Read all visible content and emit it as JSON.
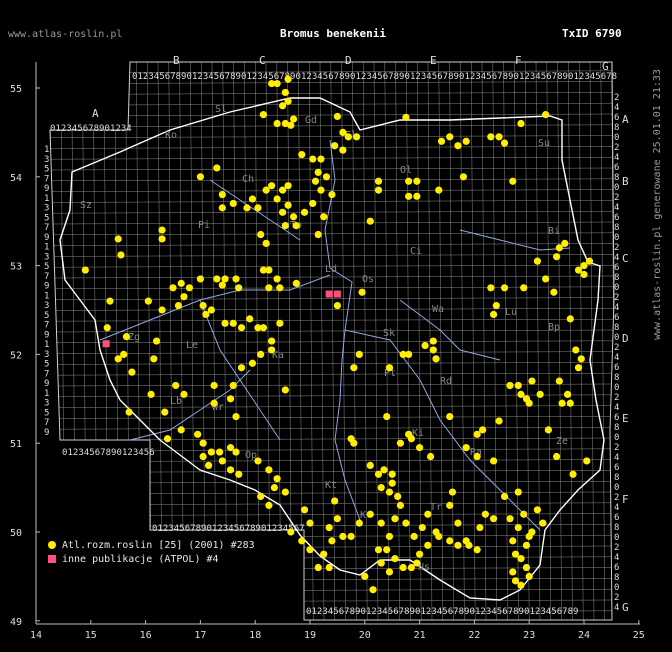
{
  "site": "www.atlas-roslin.pl",
  "title": "Bromus benekenii",
  "txid": "TxID 6790",
  "side_text": "www.atlas-roslin.pl generowane 25.01.01 21:33",
  "colors": {
    "background": "#000000",
    "grid": "#8a8a8a",
    "border": "#ffffff",
    "rivers": "#8fa8e0",
    "dot": "#ffee00",
    "square": "#ff4f7a"
  },
  "axis_x": [
    "14",
    "15",
    "16",
    "17",
    "18",
    "19",
    "20",
    "21",
    "22",
    "23",
    "24",
    "25"
  ],
  "axis_y": [
    "55",
    "54",
    "53",
    "52",
    "51",
    "50",
    "49"
  ],
  "col_letters": [
    "A",
    "B",
    "C",
    "D",
    "E",
    "F",
    "G"
  ],
  "row_letters": [
    "A",
    "B",
    "C",
    "D",
    "E",
    "F",
    "G"
  ],
  "grid_digits": "0123456789",
  "region_labels": [
    "Sz",
    "Ko",
    "Sl",
    "Gd",
    "El",
    "Ol",
    "Su",
    "Pi",
    "Ch",
    "To",
    "Bi",
    "Ci",
    "Os",
    "Ld",
    "Wa",
    "Sk",
    "Bp",
    "Le",
    "Ka",
    "Pt",
    "Rd",
    "Lu",
    "Zg",
    "Lb",
    "Wr",
    "Op",
    "Kt",
    "Ki",
    "Tr",
    "Kr",
    "Ns",
    "Ra",
    "Ze"
  ],
  "legend": [
    {
      "label": "Atl.rozm.roslin [25] (2001) #283",
      "symbol": "dot"
    },
    {
      "label": "inne publikacje (ATPOL) #4",
      "symbol": "square"
    }
  ],
  "records_dots": [
    [
      18.3,
      55.05
    ],
    [
      18.4,
      55.05
    ],
    [
      18.6,
      55.1
    ],
    [
      18.55,
      54.95
    ],
    [
      18.6,
      54.85
    ],
    [
      18.5,
      54.8
    ],
    [
      18.15,
      54.7
    ],
    [
      18.4,
      54.6
    ],
    [
      18.7,
      54.65
    ],
    [
      18.55,
      54.6
    ],
    [
      18.65,
      54.58
    ],
    [
      19.5,
      54.68
    ],
    [
      19.6,
      54.5
    ],
    [
      19.7,
      54.45
    ],
    [
      19.45,
      54.35
    ],
    [
      19.6,
      54.3
    ],
    [
      19.85,
      54.45
    ],
    [
      20.75,
      54.67
    ],
    [
      21.4,
      54.4
    ],
    [
      21.55,
      54.45
    ],
    [
      21.7,
      54.35
    ],
    [
      21.85,
      54.4
    ],
    [
      22.3,
      54.45
    ],
    [
      22.45,
      54.45
    ],
    [
      22.55,
      54.38
    ],
    [
      22.85,
      54.6
    ],
    [
      23.3,
      54.7
    ],
    [
      18.85,
      54.25
    ],
    [
      19.05,
      54.2
    ],
    [
      19.2,
      54.2
    ],
    [
      19.15,
      54.05
    ],
    [
      19.1,
      53.95
    ],
    [
      19.3,
      54.0
    ],
    [
      19.2,
      53.85
    ],
    [
      19.4,
      53.8
    ],
    [
      20.25,
      53.95
    ],
    [
      20.25,
      53.85
    ],
    [
      20.8,
      53.95
    ],
    [
      20.95,
      53.95
    ],
    [
      20.8,
      53.78
    ],
    [
      20.95,
      53.78
    ],
    [
      21.35,
      53.85
    ],
    [
      21.8,
      54.0
    ],
    [
      22.7,
      53.95
    ],
    [
      17.0,
      54.0
    ],
    [
      17.3,
      54.1
    ],
    [
      17.4,
      53.8
    ],
    [
      17.6,
      53.7
    ],
    [
      17.4,
      53.65
    ],
    [
      17.95,
      53.75
    ],
    [
      17.85,
      53.65
    ],
    [
      18.05,
      53.65
    ],
    [
      18.2,
      53.85
    ],
    [
      18.3,
      53.9
    ],
    [
      18.5,
      53.85
    ],
    [
      18.6,
      53.9
    ],
    [
      18.4,
      53.75
    ],
    [
      18.6,
      53.68
    ],
    [
      18.5,
      53.6
    ],
    [
      18.7,
      53.55
    ],
    [
      18.55,
      53.45
    ],
    [
      18.75,
      53.45
    ],
    [
      18.9,
      53.6
    ],
    [
      19.05,
      53.7
    ],
    [
      19.25,
      53.55
    ],
    [
      19.15,
      53.35
    ],
    [
      20.1,
      53.5
    ],
    [
      18.1,
      53.35
    ],
    [
      18.2,
      53.25
    ],
    [
      15.5,
      53.3
    ],
    [
      15.55,
      53.12
    ],
    [
      16.3,
      53.4
    ],
    [
      16.3,
      53.3
    ],
    [
      14.9,
      52.95
    ],
    [
      16.65,
      52.8
    ],
    [
      16.8,
      52.75
    ],
    [
      16.7,
      52.65
    ],
    [
      16.5,
      52.75
    ],
    [
      16.6,
      52.55
    ],
    [
      17.0,
      52.85
    ],
    [
      17.3,
      52.85
    ],
    [
      17.45,
      52.85
    ],
    [
      17.4,
      52.78
    ],
    [
      17.65,
      52.85
    ],
    [
      17.7,
      52.75
    ],
    [
      18.15,
      52.95
    ],
    [
      18.25,
      52.95
    ],
    [
      18.4,
      52.85
    ],
    [
      18.25,
      52.75
    ],
    [
      18.45,
      52.75
    ],
    [
      18.75,
      52.8
    ],
    [
      16.05,
      52.6
    ],
    [
      17.05,
      52.55
    ],
    [
      17.2,
      52.5
    ],
    [
      17.1,
      52.45
    ],
    [
      17.45,
      52.35
    ],
    [
      17.6,
      52.35
    ],
    [
      17.9,
      52.4
    ],
    [
      17.75,
      52.3
    ],
    [
      18.05,
      52.3
    ],
    [
      18.15,
      52.3
    ],
    [
      18.45,
      52.35
    ],
    [
      18.3,
      52.15
    ],
    [
      18.3,
      52.05
    ],
    [
      18.1,
      52.0
    ],
    [
      17.95,
      51.9
    ],
    [
      17.75,
      51.85
    ],
    [
      18.55,
      51.6
    ],
    [
      15.35,
      52.6
    ],
    [
      15.3,
      52.3
    ],
    [
      15.65,
      52.2
    ],
    [
      15.6,
      52.0
    ],
    [
      16.3,
      52.5
    ],
    [
      16.2,
      52.15
    ],
    [
      15.5,
      51.95
    ],
    [
      15.75,
      51.8
    ],
    [
      16.15,
      51.95
    ],
    [
      16.55,
      51.65
    ],
    [
      16.7,
      51.55
    ],
    [
      17.25,
      51.65
    ],
    [
      17.6,
      51.65
    ],
    [
      17.25,
      51.45
    ],
    [
      17.55,
      51.5
    ],
    [
      17.65,
      51.3
    ],
    [
      16.1,
      51.55
    ],
    [
      16.35,
      51.35
    ],
    [
      15.7,
      51.35
    ],
    [
      16.65,
      51.15
    ],
    [
      16.4,
      51.05
    ],
    [
      16.95,
      51.1
    ],
    [
      17.05,
      51.0
    ],
    [
      17.2,
      50.9
    ],
    [
      17.35,
      50.9
    ],
    [
      17.55,
      50.95
    ],
    [
      17.65,
      50.9
    ],
    [
      17.4,
      50.8
    ],
    [
      17.55,
      50.7
    ],
    [
      17.7,
      50.65
    ],
    [
      17.05,
      50.85
    ],
    [
      17.15,
      50.75
    ],
    [
      18.05,
      50.8
    ],
    [
      18.25,
      50.7
    ],
    [
      18.4,
      50.6
    ],
    [
      18.55,
      50.45
    ],
    [
      18.35,
      50.5
    ],
    [
      18.1,
      50.4
    ],
    [
      18.25,
      50.3
    ],
    [
      19.95,
      52.7
    ],
    [
      19.5,
      52.55
    ],
    [
      19.9,
      52.0
    ],
    [
      19.8,
      51.85
    ],
    [
      20.7,
      52.0
    ],
    [
      20.8,
      52.0
    ],
    [
      21.1,
      52.1
    ],
    [
      21.25,
      52.15
    ],
    [
      21.25,
      52.05
    ],
    [
      21.3,
      51.95
    ],
    [
      20.45,
      51.85
    ],
    [
      19.8,
      51.0
    ],
    [
      19.75,
      51.05
    ],
    [
      20.1,
      50.75
    ],
    [
      20.25,
      50.65
    ],
    [
      20.35,
      50.7
    ],
    [
      20.5,
      50.65
    ],
    [
      20.5,
      50.55
    ],
    [
      20.65,
      51.0
    ],
    [
      20.85,
      51.05
    ],
    [
      21.0,
      50.95
    ],
    [
      21.2,
      50.85
    ],
    [
      20.4,
      51.3
    ],
    [
      20.8,
      51.1
    ],
    [
      21.85,
      50.95
    ],
    [
      22.05,
      51.1
    ],
    [
      22.15,
      51.15
    ],
    [
      22.45,
      51.25
    ],
    [
      22.05,
      50.85
    ],
    [
      22.35,
      50.8
    ],
    [
      21.55,
      51.3
    ],
    [
      22.3,
      52.75
    ],
    [
      22.55,
      52.75
    ],
    [
      22.35,
      52.45
    ],
    [
      22.4,
      52.55
    ],
    [
      22.9,
      52.75
    ],
    [
      23.45,
      52.7
    ],
    [
      23.15,
      53.05
    ],
    [
      23.3,
      52.85
    ],
    [
      23.5,
      53.1
    ],
    [
      23.55,
      53.2
    ],
    [
      23.65,
      53.25
    ],
    [
      24.0,
      53.0
    ],
    [
      23.9,
      52.95
    ],
    [
      24.1,
      53.05
    ],
    [
      24.0,
      52.9
    ],
    [
      23.75,
      52.4
    ],
    [
      23.85,
      52.05
    ],
    [
      23.95,
      51.95
    ],
    [
      23.9,
      51.85
    ],
    [
      23.55,
      51.7
    ],
    [
      23.7,
      51.55
    ],
    [
      23.75,
      51.45
    ],
    [
      23.6,
      51.45
    ],
    [
      22.85,
      51.55
    ],
    [
      22.95,
      51.5
    ],
    [
      23.0,
      51.45
    ],
    [
      22.65,
      51.65
    ],
    [
      22.8,
      51.65
    ],
    [
      23.05,
      51.7
    ],
    [
      23.2,
      51.55
    ],
    [
      23.35,
      51.15
    ],
    [
      23.5,
      50.85
    ],
    [
      23.8,
      50.65
    ],
    [
      24.05,
      50.8
    ],
    [
      23.15,
      50.25
    ],
    [
      23.25,
      50.1
    ],
    [
      23.05,
      50.0
    ],
    [
      23.0,
      49.95
    ],
    [
      22.95,
      49.85
    ],
    [
      22.85,
      49.7
    ],
    [
      22.95,
      49.6
    ],
    [
      23.0,
      49.5
    ],
    [
      22.75,
      49.45
    ],
    [
      22.85,
      49.4
    ],
    [
      22.7,
      49.55
    ],
    [
      22.75,
      49.75
    ],
    [
      22.7,
      49.9
    ],
    [
      22.8,
      50.05
    ],
    [
      22.9,
      50.2
    ],
    [
      22.65,
      50.15
    ],
    [
      22.55,
      50.4
    ],
    [
      22.8,
      50.45
    ],
    [
      22.35,
      50.15
    ],
    [
      22.2,
      50.2
    ],
    [
      22.1,
      50.05
    ],
    [
      21.9,
      49.85
    ],
    [
      22.05,
      49.8
    ],
    [
      21.85,
      49.9
    ],
    [
      21.7,
      49.85
    ],
    [
      21.55,
      49.9
    ],
    [
      21.35,
      49.95
    ],
    [
      21.15,
      49.85
    ],
    [
      21.0,
      49.75
    ],
    [
      20.95,
      49.65
    ],
    [
      20.85,
      49.6
    ],
    [
      20.7,
      49.6
    ],
    [
      20.55,
      49.7
    ],
    [
      20.4,
      49.8
    ],
    [
      20.25,
      49.8
    ],
    [
      20.3,
      49.65
    ],
    [
      20.45,
      49.55
    ],
    [
      20.15,
      49.35
    ],
    [
      20.0,
      49.5
    ],
    [
      19.75,
      49.95
    ],
    [
      19.9,
      50.1
    ],
    [
      20.1,
      50.2
    ],
    [
      20.3,
      50.1
    ],
    [
      20.45,
      49.95
    ],
    [
      20.55,
      50.15
    ],
    [
      20.65,
      50.3
    ],
    [
      20.75,
      50.1
    ],
    [
      20.9,
      49.95
    ],
    [
      21.05,
      50.05
    ],
    [
      21.15,
      50.2
    ],
    [
      21.3,
      50.0
    ],
    [
      21.55,
      50.3
    ],
    [
      21.6,
      50.45
    ],
    [
      21.7,
      50.1
    ],
    [
      19.6,
      49.95
    ],
    [
      19.4,
      49.9
    ],
    [
      19.25,
      49.75
    ],
    [
      19.35,
      49.6
    ],
    [
      19.15,
      49.6
    ],
    [
      19.0,
      49.8
    ],
    [
      18.85,
      49.9
    ],
    [
      18.65,
      50.0
    ],
    [
      19.0,
      50.1
    ],
    [
      19.35,
      50.05
    ],
    [
      19.5,
      50.15
    ],
    [
      18.9,
      50.25
    ],
    [
      19.45,
      50.35
    ],
    [
      20.3,
      50.5
    ],
    [
      20.45,
      50.45
    ],
    [
      20.6,
      50.4
    ]
  ],
  "records_squares": [
    [
      19.35,
      52.68
    ],
    [
      19.5,
      52.68
    ],
    [
      15.28,
      52.12
    ]
  ]
}
